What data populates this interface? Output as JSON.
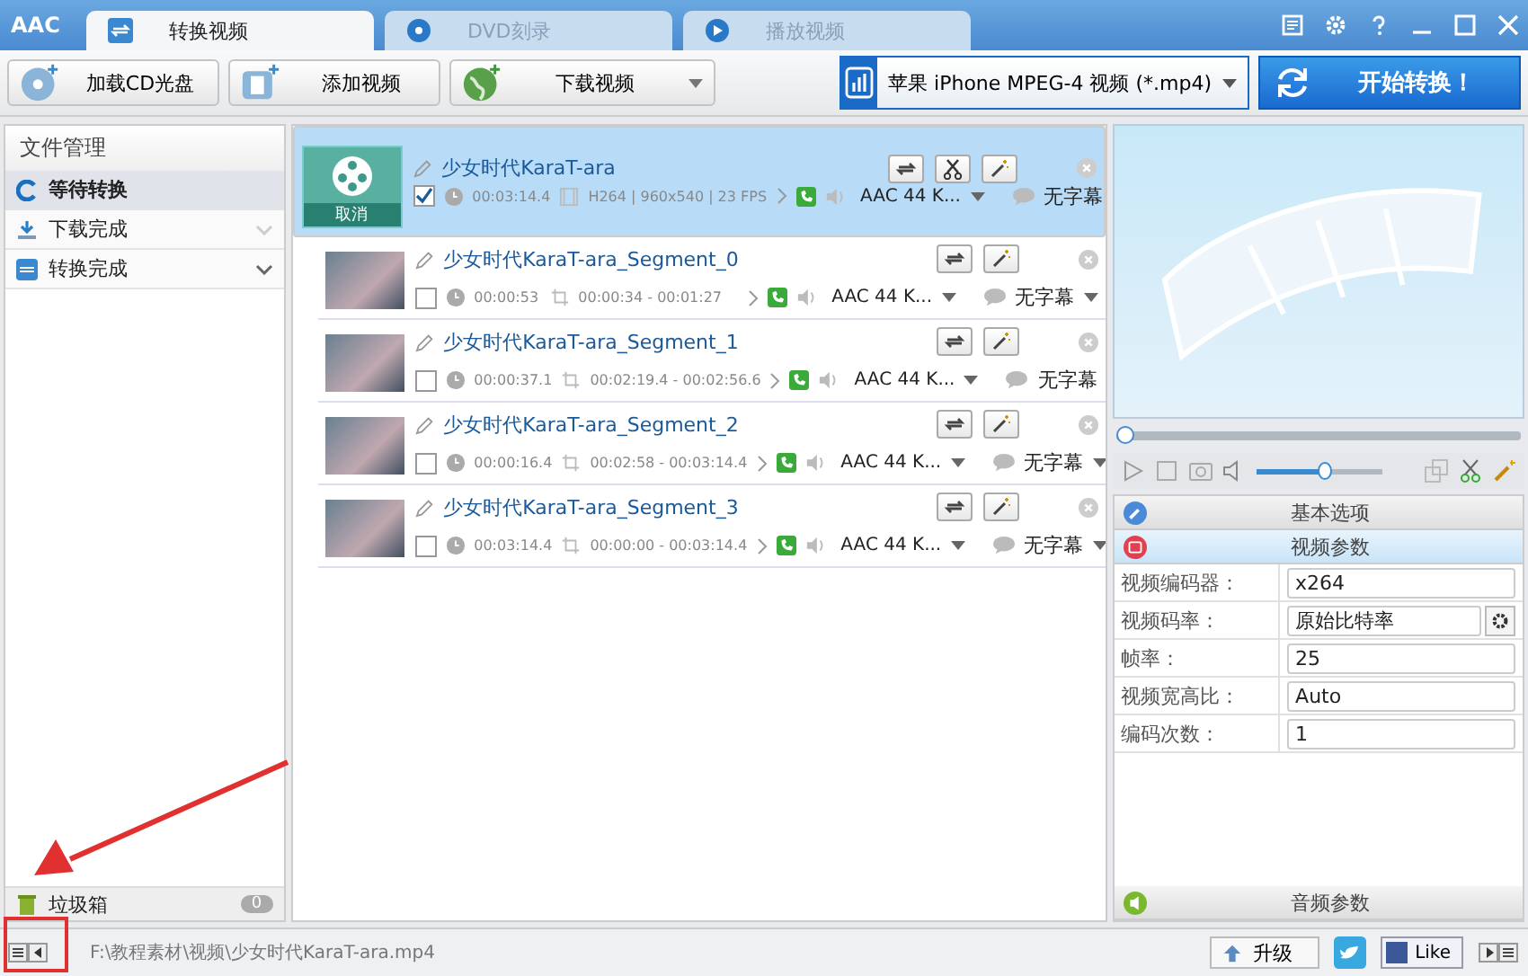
{
  "app": {
    "logo": "AAC"
  },
  "tabs": [
    {
      "label": "转换视频",
      "selected": true
    },
    {
      "label": "DVD刻录",
      "selected": false
    },
    {
      "label": "播放视频",
      "selected": false
    }
  ],
  "toolbar": {
    "buttons": [
      "加载CD光盘",
      "添加视频",
      "下载视频"
    ],
    "profile": "苹果 iPhone MPEG-4 视频 (*.mp4)",
    "start": "开始转换！"
  },
  "sidebar": {
    "title": "文件管理",
    "items": [
      {
        "label": "等待转换",
        "selected": true,
        "expandable": false
      },
      {
        "label": "下载完成",
        "selected": false,
        "expandable": true
      },
      {
        "label": "转换完成",
        "selected": false,
        "expandable": true
      }
    ],
    "trash": {
      "label": "垃圾箱",
      "count": "0"
    }
  },
  "files": [
    {
      "name": "少女时代KaraT-ara",
      "thumb_label": "取消",
      "checked": true,
      "selected": true,
      "duration": "00:03:14.4",
      "info": "H264 | 960x540 | 23 FPS",
      "audio": "AAC 44 K...",
      "subtitle": "无字幕",
      "children": [
        {
          "name": "少女时代KaraT-ara_Segment_0",
          "checked": false,
          "selected": false,
          "duration": "00:00:53",
          "range": "00:00:34 - 00:01:27",
          "audio": "AAC 44 K...",
          "subtitle": "无字幕"
        },
        {
          "name": "少女时代KaraT-ara_Segment_1",
          "checked": false,
          "selected": false,
          "duration": "00:00:37.1",
          "range": "00:02:19.4 - 00:02:56.6",
          "audio": "AAC 44 K...",
          "subtitle": "无字幕"
        },
        {
          "name": "少女时代KaraT-ara_Segment_2",
          "checked": false,
          "selected": false,
          "duration": "00:00:16.4",
          "range": "00:02:58 - 00:03:14.4",
          "audio": "AAC 44 K...",
          "subtitle": "无字幕"
        },
        {
          "name": "少女时代KaraT-ara_Segment_3",
          "checked": false,
          "selected": false,
          "duration": "00:03:14.4",
          "range": "00:00:00 - 00:03:14.4",
          "audio": "AAC 44 K...",
          "subtitle": "无字幕"
        }
      ]
    }
  ],
  "player": {
    "progress": {
      "level": 0.01
    },
    "volume": {
      "level": 0.55
    }
  },
  "settings": {
    "sections": [
      {
        "label": "基本选项",
        "selected": false
      },
      {
        "label": "视频参数",
        "selected": true
      }
    ],
    "params": [
      {
        "label": "视频编码器：",
        "value": "x264",
        "kind": "select"
      },
      {
        "label": "视频码率：",
        "value": "原始比特率",
        "kind": "select-gear"
      },
      {
        "label": "帧率：",
        "value": "25",
        "kind": "select"
      },
      {
        "label": "视频宽高比：",
        "value": "Auto",
        "kind": "select"
      },
      {
        "label": "编码次数：",
        "value": "1",
        "kind": "select"
      }
    ],
    "audio_section": "音频参数"
  },
  "status_bar": {
    "path": "F:\\教程素材\\视频\\少女时代KaraT-ara.mp4",
    "upgrade": "升级",
    "like": "Like"
  }
}
